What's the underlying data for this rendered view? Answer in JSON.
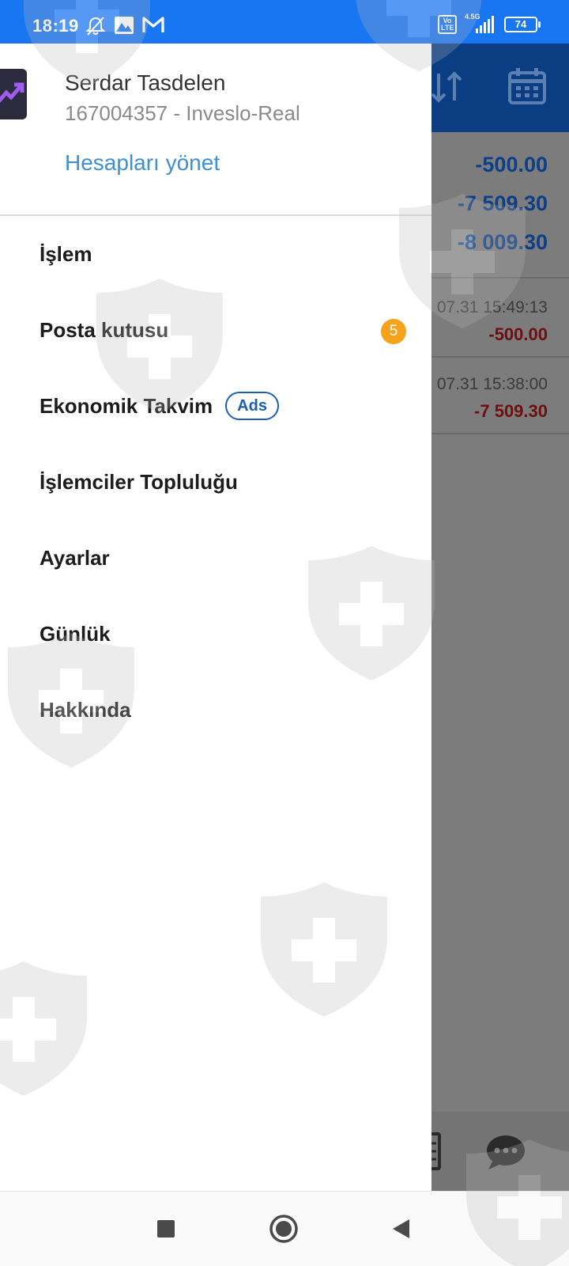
{
  "status_bar": {
    "time": "18:19",
    "network_label": "4.5G",
    "volte_label": "Vo LTE",
    "battery": "74"
  },
  "background_app": {
    "balances": [
      "-500.00",
      "-7 509.30",
      "-8 009.30"
    ],
    "rows": [
      {
        "date": "07.31 15:49:13",
        "amount": "-500.00"
      },
      {
        "date": "07.31 15:38:00",
        "amount": "-7 509.30"
      }
    ]
  },
  "drawer": {
    "user_name": "Serdar Tasdelen",
    "account": "167004357 - Inveslo-Real",
    "manage_accounts": "Hesapları yönet",
    "menu": [
      {
        "label": "İşlem"
      },
      {
        "label": "Posta kutusu",
        "badge": "5"
      },
      {
        "label": "Ekonomik Takvim",
        "tag": "Ads"
      },
      {
        "label": "İşlemciler Topluluğu"
      },
      {
        "label": "Ayarlar"
      },
      {
        "label": "Günlük"
      },
      {
        "label": "Hakkında"
      }
    ]
  },
  "colors": {
    "status_bar": "#1976f2",
    "app_header": "#0a3d82",
    "link": "#3e8fd6",
    "badge": "#f7a21b",
    "ads_tag": "#1a5fb4",
    "negative": "#6e0e0e"
  },
  "icons": {
    "status_bar": [
      "mute-notifications-icon",
      "gallery-icon",
      "gmail-icon",
      "signal-icon",
      "battery-icon"
    ],
    "app_header": [
      "sort-icon",
      "calendar-icon"
    ],
    "app_bottom": [
      "document-icon",
      "chat-icon"
    ],
    "navigation": [
      "recents-square-icon",
      "home-circle-icon",
      "back-triangle-icon"
    ]
  }
}
